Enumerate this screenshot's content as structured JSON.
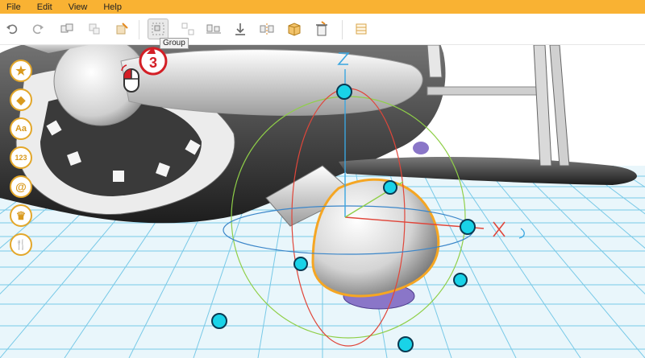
{
  "menu": {
    "items": [
      "File",
      "Edit",
      "View",
      "Help"
    ]
  },
  "toolbar": {
    "buttons": [
      {
        "icon": "undo-icon"
      },
      {
        "icon": "redo-icon"
      },
      {
        "icon": "copy-icon"
      },
      {
        "icon": "paste-icon"
      },
      {
        "icon": "import-icon"
      },
      {
        "icon": "group-icon"
      },
      {
        "icon": "ungroup-icon"
      },
      {
        "icon": "align-icon"
      },
      {
        "icon": "drop-to-ground-icon"
      },
      {
        "icon": "mirror-icon"
      },
      {
        "icon": "box-icon"
      },
      {
        "icon": "delete-icon"
      },
      {
        "icon": "grid-icon"
      }
    ],
    "tooltip": "Group"
  },
  "sidebar": {
    "buttons": [
      {
        "icon": "star-icon",
        "label": "★"
      },
      {
        "icon": "shape-icon",
        "label": "◆"
      },
      {
        "icon": "text-icon",
        "label": "Aa"
      },
      {
        "icon": "number-icon",
        "label": "123"
      },
      {
        "icon": "symbol-icon",
        "label": "@"
      },
      {
        "icon": "crown-icon",
        "label": "♛"
      },
      {
        "icon": "tools-icon",
        "label": "🍴"
      }
    ]
  },
  "callout": {
    "step": "3"
  },
  "gizmo": {
    "z_label": "Z",
    "x_label": "X"
  },
  "colors": {
    "accent": "#f9b233",
    "grid": "#6ec6e6",
    "handle": "#19d3e8",
    "selection": "#f5a623"
  }
}
